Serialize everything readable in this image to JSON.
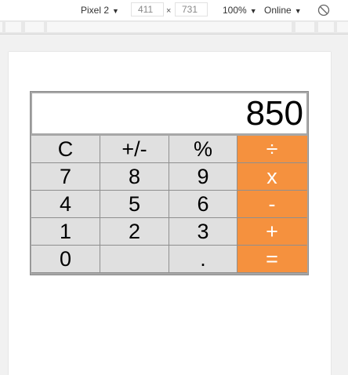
{
  "devtools": {
    "device": "Pixel 2",
    "width": "411",
    "times": "×",
    "height": "731",
    "zoom": "100%",
    "network": "Online"
  },
  "calculator": {
    "display": "850",
    "rows": [
      [
        {
          "label": "C",
          "op": false
        },
        {
          "label": "+/-",
          "op": false
        },
        {
          "label": "%",
          "op": false
        },
        {
          "label": "÷",
          "op": true
        }
      ],
      [
        {
          "label": "7",
          "op": false
        },
        {
          "label": "8",
          "op": false
        },
        {
          "label": "9",
          "op": false
        },
        {
          "label": "x",
          "op": true
        }
      ],
      [
        {
          "label": "4",
          "op": false
        },
        {
          "label": "5",
          "op": false
        },
        {
          "label": "6",
          "op": false
        },
        {
          "label": "-",
          "op": true
        }
      ],
      [
        {
          "label": "1",
          "op": false
        },
        {
          "label": "2",
          "op": false
        },
        {
          "label": "3",
          "op": false
        },
        {
          "label": "+",
          "op": true
        }
      ],
      [
        {
          "label": "0",
          "op": false
        },
        {
          "label": "",
          "op": false
        },
        {
          "label": ".",
          "op": false
        },
        {
          "label": "=",
          "op": true
        }
      ]
    ]
  },
  "colors": {
    "operator": "#f5913e",
    "key": "#e0e0e0",
    "display_bg": "#ffffff"
  }
}
